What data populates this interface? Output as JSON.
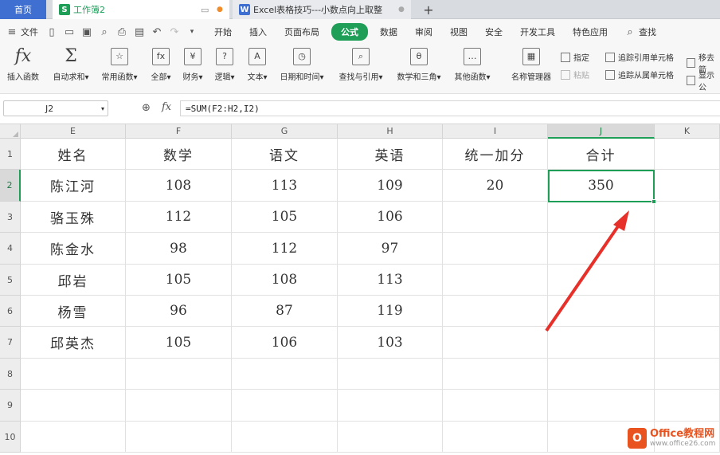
{
  "tabs": {
    "home": "首页",
    "workbook": "工作簿2",
    "document": "Excel表格技巧---小数点向上取整",
    "new_tab": "+"
  },
  "menu": {
    "file": "文件",
    "tabs": [
      "开始",
      "插入",
      "页面布局",
      "公式",
      "数据",
      "审阅",
      "视图",
      "安全",
      "开发工具",
      "特色应用"
    ],
    "active_tab": "公式",
    "search": "查找"
  },
  "ribbon": {
    "insert_function": "插入函数",
    "autosum": "自动求和",
    "common_functions": "常用函数",
    "all": "全部",
    "financial": "财务",
    "logical": "逻辑",
    "text": "文本",
    "datetime": "日期和时间",
    "lookup": "查找与引用",
    "math": "数学和三角",
    "other": "其他函数",
    "name_manager": "名称管理器",
    "define": "指定",
    "paste": "粘贴",
    "trace_precedents": "追踪引用单元格",
    "trace_dependents": "追踪从属单元格",
    "remove_arrows": "移去箭",
    "show_formulas": "显示公"
  },
  "formula_bar": {
    "name_box": "J2",
    "formula": "=SUM(F2:H2,I2)"
  },
  "sheet": {
    "columns": [
      "E",
      "F",
      "G",
      "H",
      "I",
      "J",
      "K"
    ],
    "rows": [
      "1",
      "2",
      "3",
      "4",
      "5",
      "6",
      "7",
      "8",
      "9",
      "10"
    ],
    "data": [
      [
        "姓名",
        "数学",
        "语文",
        "英语",
        "统一加分",
        "合计"
      ],
      [
        "陈江河",
        "108",
        "113",
        "109",
        "20",
        "350"
      ],
      [
        "骆玉殊",
        "112",
        "105",
        "106",
        "",
        ""
      ],
      [
        "陈金水",
        "98",
        "112",
        "97",
        "",
        ""
      ],
      [
        "邱岩",
        "105",
        "108",
        "113",
        "",
        ""
      ],
      [
        "杨雪",
        "96",
        "87",
        "119",
        "",
        ""
      ],
      [
        "邱英杰",
        "105",
        "106",
        "103",
        "",
        ""
      ]
    ],
    "selected_cell": "J2"
  },
  "watermark": {
    "brand": "Office教程网",
    "url": "www.office26.com"
  },
  "colors": {
    "accent_green": "#1f9e57",
    "tab_blue": "#3f6fd1",
    "arrow_red": "#e8302a"
  }
}
